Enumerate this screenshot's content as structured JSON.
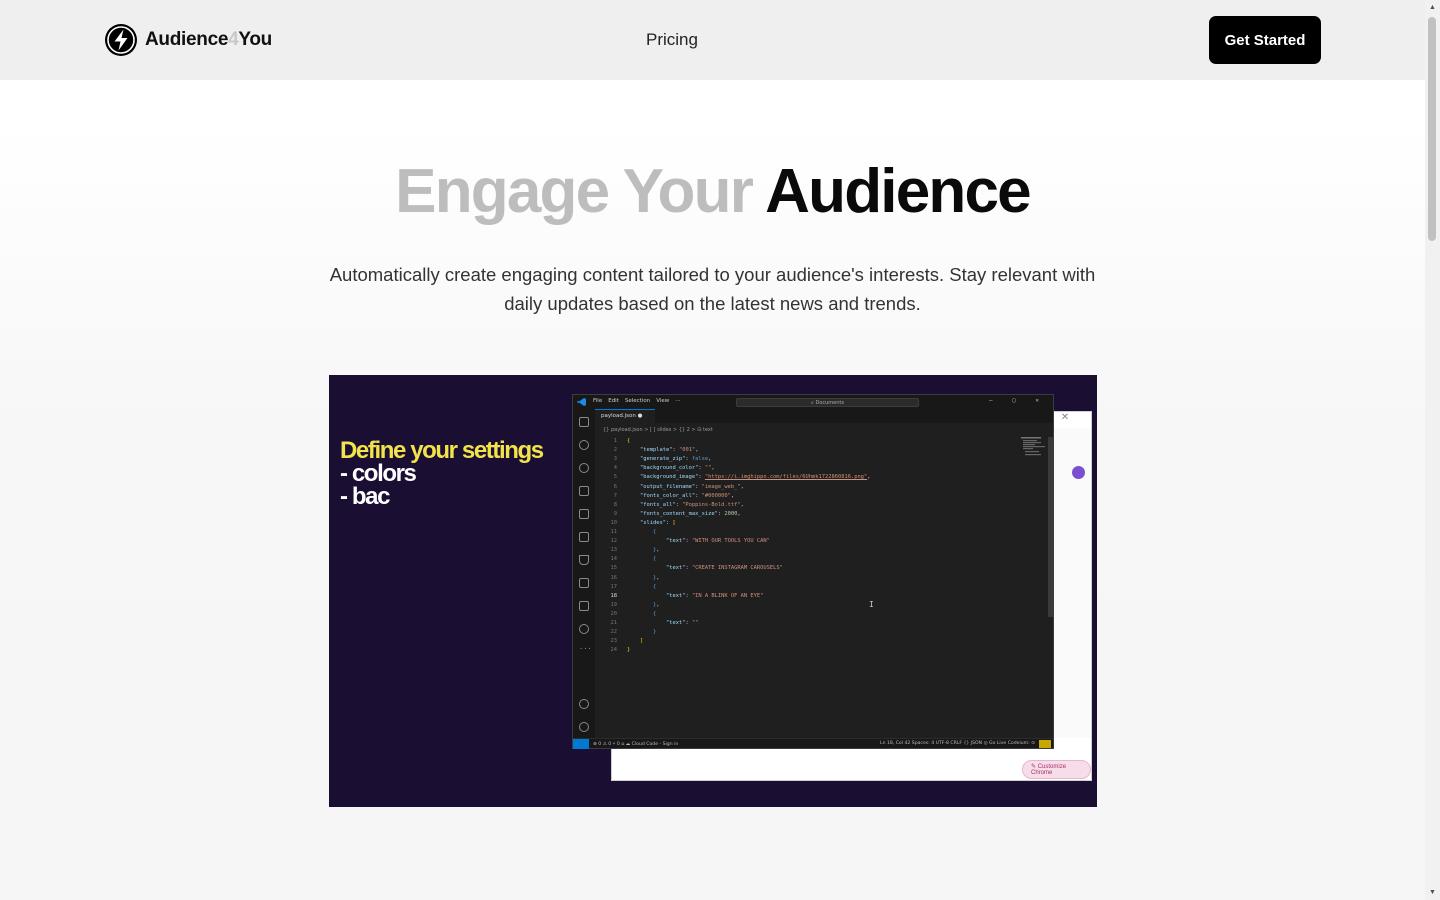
{
  "header": {
    "brand_part1": "Audience",
    "brand_part2": "4",
    "brand_part3": "You",
    "nav_pricing": "Pricing",
    "cta_label": "Get Started"
  },
  "hero": {
    "title_muted": "Engage Your",
    "title_strong": "Audience",
    "subtitle": "Automatically create engaging content tailored to your audience's interests. Stay relevant with daily updates based on the latest news and trends."
  },
  "video": {
    "overlay_line1": "Define your settings",
    "overlay_line2": "- colors",
    "overlay_line3": "- bac",
    "editor": {
      "menu": [
        "File",
        "Edit",
        "Selection",
        "View",
        "···"
      ],
      "search": "Documents",
      "tab": "payload.json",
      "breadcrumbs": "{} payload.json > [ ] slides > {} 2 > ⊟ text",
      "code_lines": [
        {
          "n": "1",
          "html": "<span class='b'>{</span>"
        },
        {
          "n": "2",
          "html": "    <span class='k'>\"template\"</span><span class='p'>: </span><span class='s'>\"001\"</span><span class='p'>,</span>"
        },
        {
          "n": "3",
          "html": "    <span class='k'>\"generate_zip\"</span><span class='p'>: </span><span class='bl'>false</span><span class='p'>,</span>"
        },
        {
          "n": "4",
          "html": "    <span class='k'>\"background_color\"</span><span class='p'>: </span><span class='s'>\"\"</span><span class='p'>,</span>"
        },
        {
          "n": "5",
          "html": "    <span class='k'>\"background_image\"</span><span class='p'>: </span><span class='u'>\"https://i.imghippo.com/files/6Uhmk1722860816.png\"</span><span class='p'>,</span>"
        },
        {
          "n": "6",
          "html": "    <span class='k'>\"output_filename\"</span><span class='p'>: </span><span class='s'>\"image_web_\"</span><span class='p'>,</span>"
        },
        {
          "n": "7",
          "html": "    <span class='k'>\"fonts_color_all\"</span><span class='p'>: </span><span class='s'>\"#000000\"</span><span class='p'>,</span>"
        },
        {
          "n": "8",
          "html": "    <span class='k'>\"fonts_all\"</span><span class='p'>: </span><span class='s'>\"Poppins-Bold.ttf\"</span><span class='p'>,</span>"
        },
        {
          "n": "9",
          "html": "    <span class='k'>\"fonts_content_max_size\"</span><span class='p'>: </span><span class='n'>2000</span><span class='p'>,</span>"
        },
        {
          "n": "10",
          "html": "    <span class='k'>\"slides\"</span><span class='p'>: </span><span class='b'>[</span>"
        },
        {
          "n": "11",
          "html": "        <span class='bl'>{</span>"
        },
        {
          "n": "12",
          "html": "            <span class='k'>\"text\"</span><span class='p'>: </span><span class='s'>\"WITH OUR TOOLS YOU CAN\"</span>"
        },
        {
          "n": "13",
          "html": "        <span class='bl'>}</span><span class='p'>,</span>"
        },
        {
          "n": "14",
          "html": "        <span class='bl'>{</span>"
        },
        {
          "n": "15",
          "html": "            <span class='k'>\"text\"</span><span class='p'>: </span><span class='s'>\"CREATE INSTAGRAM CAROUSELS\"</span>"
        },
        {
          "n": "16",
          "html": "        <span class='bl'>}</span><span class='p'>,</span>"
        },
        {
          "n": "17",
          "html": "        <span class='bl'>{</span>"
        },
        {
          "n": "18",
          "html": "            <span class='k'>\"text\"</span><span class='p'>: </span><span class='s'>\"IN A BLINK OF AN EYE\"</span>",
          "cur": true
        },
        {
          "n": "19",
          "html": "        <span class='bl'>}</span><span class='p'>,</span>"
        },
        {
          "n": "20",
          "html": "        <span class='bl'>{</span>"
        },
        {
          "n": "21",
          "html": "            <span class='k'>\"text\"</span><span class='p'>: </span><span class='s'>\"\"</span>"
        },
        {
          "n": "22",
          "html": "        <span class='bl'>}</span>"
        },
        {
          "n": "23",
          "html": "    <span class='b'>]</span>"
        },
        {
          "n": "24",
          "html": "<span class='b'>}</span>"
        }
      ],
      "status_left": "⊗ 0 ⚠ 0   ⑂ 0   ⌂   ☁ Cloud Code - Sign in",
      "status_right": "Ln 18, Col 42   Spaces: 4   UTF-8   CRLF   {} JSON   ◎ Go Live   Codeium: ⊙"
    },
    "browser_pill": "✎ Customize Chrome"
  },
  "colors": {
    "brand_black": "#000000",
    "muted_title": "#bdbdbd",
    "video_bg": "#1a0e33"
  }
}
